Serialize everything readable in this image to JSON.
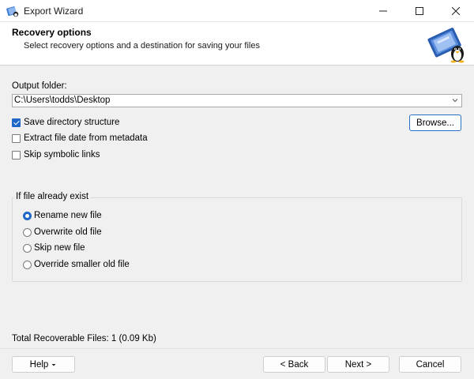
{
  "window": {
    "title": "Export Wizard",
    "icons": {
      "app": "export-wizard-app-icon",
      "minimize": "minimize-icon",
      "maximize": "maximize-icon",
      "close": "close-icon"
    }
  },
  "header": {
    "title": "Recovery options",
    "subtitle": "Select recovery options and a destination for saving your files",
    "logo": "penguin-disk-logo"
  },
  "output": {
    "label": "Output folder:",
    "value": "C:\\Users\\todds\\Desktop",
    "browse_label": "Browse..."
  },
  "options": [
    {
      "label": "Save directory structure",
      "checked": true
    },
    {
      "label": "Extract file date from metadata",
      "checked": false
    },
    {
      "label": "Skip symbolic links",
      "checked": false
    }
  ],
  "exist_group": {
    "title": "If file already exist",
    "choices": [
      {
        "label": "Rename new file",
        "selected": true
      },
      {
        "label": "Overwrite old file",
        "selected": false
      },
      {
        "label": "Skip new file",
        "selected": false
      },
      {
        "label": "Override smaller old file",
        "selected": false
      }
    ]
  },
  "status": {
    "text": "Total Recoverable Files: 1 (0.09 Kb)"
  },
  "footer": {
    "help_label": "Help",
    "back_label": "< Back",
    "next_label": "Next >",
    "cancel_label": "Cancel"
  },
  "colors": {
    "accent": "#1f66c8",
    "background": "#f0f0f0",
    "header_background": "#ffffff"
  }
}
